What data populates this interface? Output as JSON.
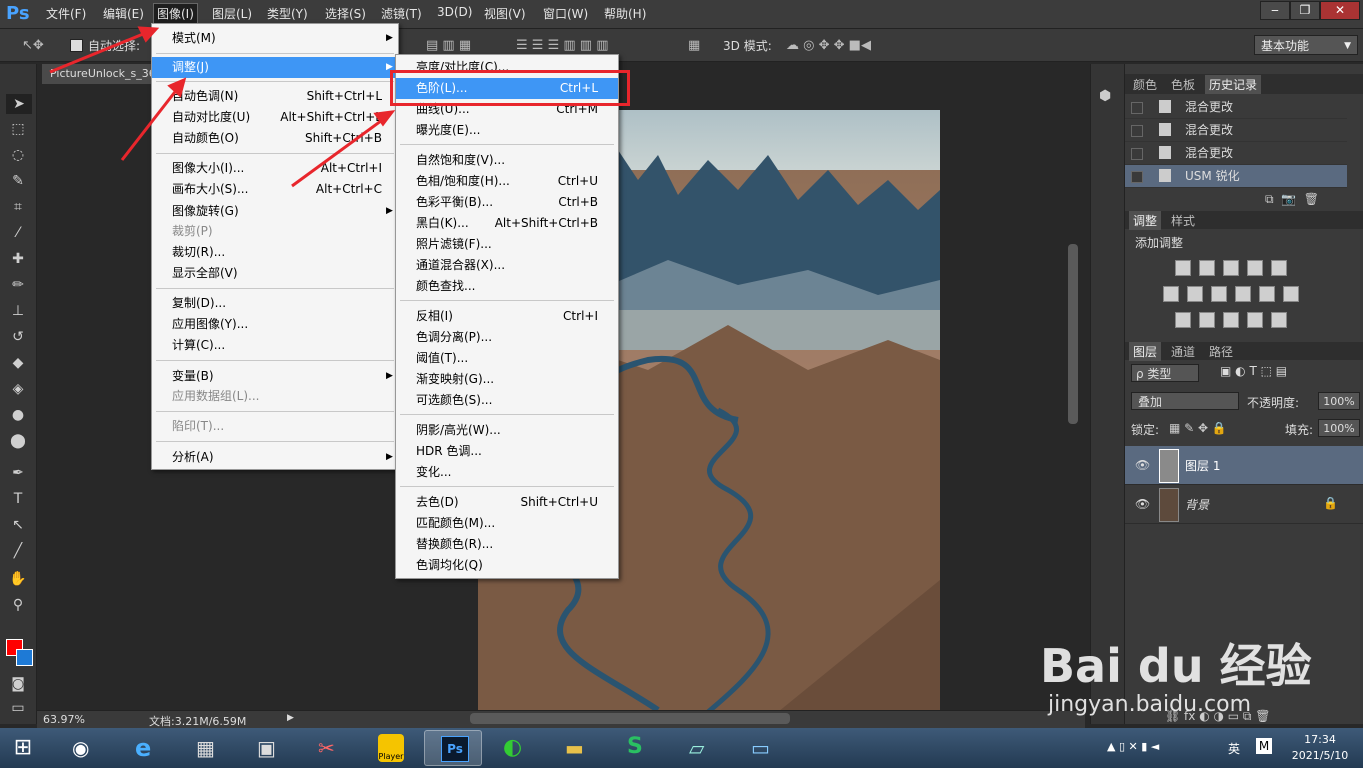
{
  "menubar": {
    "logo": "Ps",
    "items": [
      "文件(F)",
      "编辑(E)",
      "图像(I)",
      "图层(L)",
      "类型(Y)",
      "选择(S)",
      "滤镜(T)",
      "3D(D)",
      "视图(V)",
      "窗口(W)",
      "帮助(H)"
    ],
    "win_min": "‒",
    "win_restore": "❐",
    "win_close": "✕"
  },
  "options": {
    "auto_select": "自动选择:",
    "mode3d": "3D 模式:",
    "workspace": "基本功能"
  },
  "document": {
    "tab_title": "PictureUnlock_s_36",
    "zoom": "63.97%",
    "file_info": "文档:3.21M/6.59M"
  },
  "image_menu": {
    "items": [
      {
        "label": "模式(M)",
        "shortcut": "",
        "sub": true,
        "disabled": false
      },
      {
        "label": "调整(J)",
        "shortcut": "",
        "sub": true,
        "disabled": false
      },
      {
        "label": "自动色调(N)",
        "shortcut": "Shift+Ctrl+L",
        "sub": false,
        "disabled": false
      },
      {
        "label": "自动对比度(U)",
        "shortcut": "Alt+Shift+Ctrl+L",
        "sub": false,
        "disabled": false
      },
      {
        "label": "自动颜色(O)",
        "shortcut": "Shift+Ctrl+B",
        "sub": false,
        "disabled": false
      },
      {
        "label": "图像大小(I)...",
        "shortcut": "Alt+Ctrl+I",
        "sub": false,
        "disabled": false
      },
      {
        "label": "画布大小(S)...",
        "shortcut": "Alt+Ctrl+C",
        "sub": false,
        "disabled": false
      },
      {
        "label": "图像旋转(G)",
        "shortcut": "",
        "sub": true,
        "disabled": false
      },
      {
        "label": "裁剪(P)",
        "shortcut": "",
        "sub": false,
        "disabled": true
      },
      {
        "label": "裁切(R)...",
        "shortcut": "",
        "sub": false,
        "disabled": false
      },
      {
        "label": "显示全部(V)",
        "shortcut": "",
        "sub": false,
        "disabled": false
      },
      {
        "label": "复制(D)...",
        "shortcut": "",
        "sub": false,
        "disabled": false
      },
      {
        "label": "应用图像(Y)...",
        "shortcut": "",
        "sub": false,
        "disabled": false
      },
      {
        "label": "计算(C)...",
        "shortcut": "",
        "sub": false,
        "disabled": false
      },
      {
        "label": "变量(B)",
        "shortcut": "",
        "sub": true,
        "disabled": false
      },
      {
        "label": "应用数据组(L)...",
        "shortcut": "",
        "sub": false,
        "disabled": true
      },
      {
        "label": "陷印(T)...",
        "shortcut": "",
        "sub": false,
        "disabled": true
      },
      {
        "label": "分析(A)",
        "shortcut": "",
        "sub": true,
        "disabled": false
      }
    ]
  },
  "adjust_menu": {
    "items": [
      {
        "label": "亮度/对比度(C)...",
        "shortcut": ""
      },
      {
        "label": "色阶(L)...",
        "shortcut": "Ctrl+L"
      },
      {
        "label": "曲线(U)...",
        "shortcut": "Ctrl+M"
      },
      {
        "label": "曝光度(E)...",
        "shortcut": ""
      },
      {
        "label": "自然饱和度(V)...",
        "shortcut": ""
      },
      {
        "label": "色相/饱和度(H)...",
        "shortcut": "Ctrl+U"
      },
      {
        "label": "色彩平衡(B)...",
        "shortcut": "Ctrl+B"
      },
      {
        "label": "黑白(K)...",
        "shortcut": "Alt+Shift+Ctrl+B"
      },
      {
        "label": "照片滤镜(F)...",
        "shortcut": ""
      },
      {
        "label": "通道混合器(X)...",
        "shortcut": ""
      },
      {
        "label": "颜色查找...",
        "shortcut": ""
      },
      {
        "label": "反相(I)",
        "shortcut": "Ctrl+I"
      },
      {
        "label": "色调分离(P)...",
        "shortcut": ""
      },
      {
        "label": "阈值(T)...",
        "shortcut": ""
      },
      {
        "label": "渐变映射(G)...",
        "shortcut": ""
      },
      {
        "label": "可选颜色(S)...",
        "shortcut": ""
      },
      {
        "label": "阴影/高光(W)...",
        "shortcut": ""
      },
      {
        "label": "HDR 色调...",
        "shortcut": ""
      },
      {
        "label": "变化...",
        "shortcut": ""
      },
      {
        "label": "去色(D)",
        "shortcut": "Shift+Ctrl+U"
      },
      {
        "label": "匹配颜色(M)...",
        "shortcut": ""
      },
      {
        "label": "替换颜色(R)...",
        "shortcut": ""
      },
      {
        "label": "色调均化(Q)",
        "shortcut": ""
      }
    ]
  },
  "panels": {
    "top_tabs": [
      "颜色",
      "色板",
      "历史记录"
    ],
    "history": [
      "混合更改",
      "混合更改",
      "混合更改",
      "USM 锐化"
    ],
    "adj_tabs": [
      "调整",
      "样式"
    ],
    "adj_title": "添加调整",
    "layer_tabs": [
      "图层",
      "通道",
      "路径"
    ],
    "filter_label": "ρ 类型",
    "blend_mode": "叠加",
    "opacity_label": "不透明度:",
    "opacity_value": "100%",
    "lock_label": "锁定:",
    "fill_label": "填充:",
    "fill_value": "100%",
    "layers": [
      {
        "name": "图层 1"
      },
      {
        "name": "背景"
      }
    ]
  },
  "watermark": {
    "brand": "Bai du 经验",
    "url": "jingyan.baidu.com"
  },
  "taskbar": {
    "time": "17:34",
    "date": "2021/5/10",
    "ime": "英",
    "ime2": "M",
    "player_label": "Player"
  },
  "colors": {
    "highlight": "#3e96f5",
    "annotation": "#e8262c",
    "fg": "#ff0000",
    "bg": "#1e7ad6"
  }
}
